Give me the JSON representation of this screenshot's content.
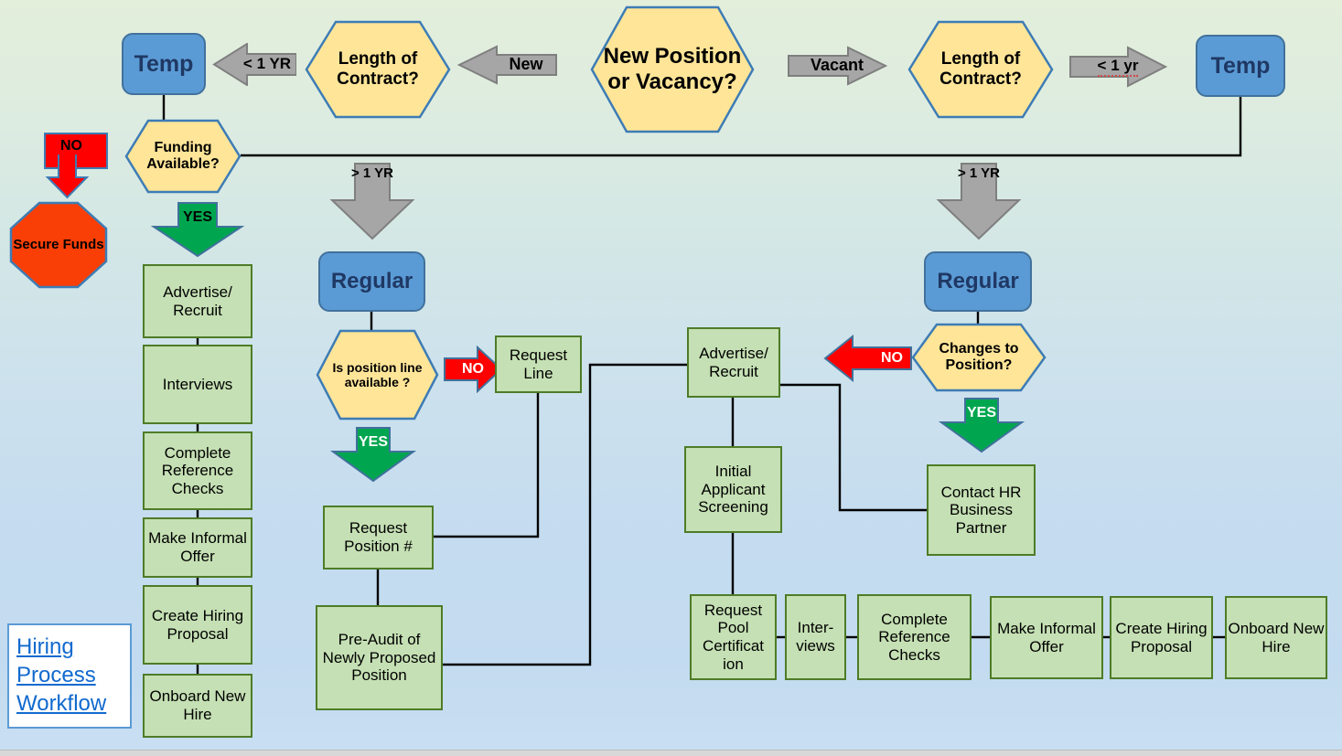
{
  "title_box": {
    "line1": "Hiring",
    "line2": "Process",
    "line3": "Workflow"
  },
  "colors": {
    "blue_fill": "#5b9bd5",
    "blue_stroke": "#41719c",
    "blue_text": "#1f3864",
    "green_fill": "#c5e0b4",
    "green_stroke": "#4e7c27",
    "hex_fill": "#ffe598",
    "hex_stroke": "#3d7cb5",
    "gray_arrow_fill": "#a6a6a6",
    "gray_arrow_stroke": "#7f7f7f",
    "red_arrow_fill": "#fe0000",
    "green_arrow_fill": "#00a64f",
    "octagon_fill": "#fa3f06",
    "link_blue": "#1169cf",
    "connector": "#000000"
  },
  "nodes": {
    "start_decision": "New Position or Vacancy?",
    "new_arrow": "New",
    "vacant_arrow": "Vacant",
    "length_of_contract_left": "Length of Contract?",
    "length_of_contract_right": "Length of Contract?",
    "lt1yr_left": "< 1 YR",
    "lt1yr_right": "< 1 yr",
    "gt1yr_left": "> 1 YR",
    "gt1yr_right": "> 1 YR",
    "temp_left": "Temp",
    "temp_right": "Temp",
    "regular_left": "Regular",
    "regular_right": "Regular",
    "funding_available": "Funding Available?",
    "funding_no": "NO",
    "funding_yes": "YES",
    "secure_funds": "Secure Funds",
    "left_chain": [
      "Advertise/ Recruit",
      "Interviews",
      "Complete Reference Checks",
      "Make Informal Offer",
      "Create Hiring Proposal",
      "Onboard New Hire"
    ],
    "is_position_line_available": "Is position line available ?",
    "position_no": "NO",
    "position_yes": "YES",
    "request_line": "Request Line",
    "request_position_number": "Request Position #",
    "pre_audit": "Pre-Audit of Newly Proposed Position",
    "changes_to_position": "Changes to Position?",
    "changes_no": "NO",
    "changes_yes": "YES",
    "contact_hr": "Contact HR Business Partner",
    "advertise_recruit_right": "Advertise/ Recruit",
    "initial_applicant_screening": "Initial Applicant Screening",
    "bottom_chain": [
      "Request Pool Certificat ion",
      "Inter- views",
      "Complete Reference Checks",
      "Make Informal Offer",
      "Create Hiring Proposal",
      "Onboard New Hire"
    ]
  }
}
